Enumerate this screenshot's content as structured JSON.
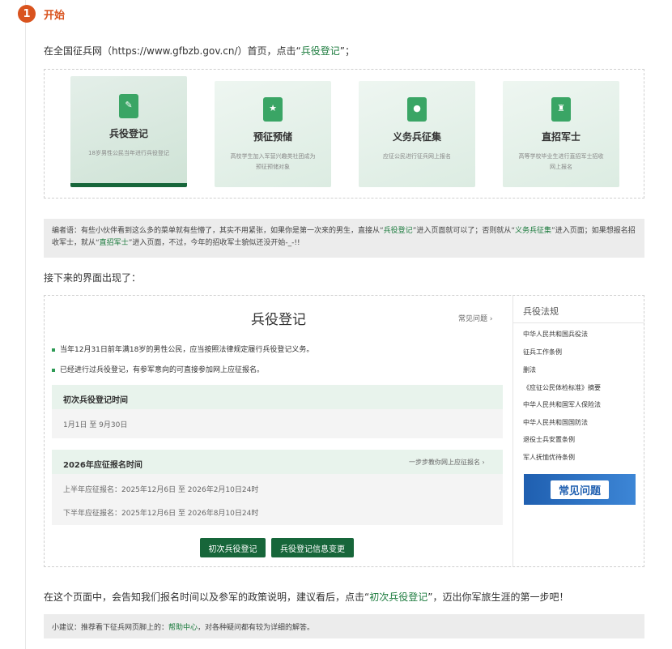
{
  "step": {
    "number": "1",
    "title": "开始"
  },
  "intro": {
    "prefix": "在全国征兵网（https://www.gfbzb.gov.cn/）首页，点击“",
    "link": "兵役登记",
    "suffix": "”；"
  },
  "cards": [
    {
      "title": "兵役登记",
      "desc": "18岁男性公民当年进行兵役登记",
      "icon": "registration-icon",
      "active": true
    },
    {
      "title": "预征预储",
      "desc": "高校学生加入军营兴趣类社团成为预征预储对象",
      "icon": "bookmark-star-icon",
      "active": false
    },
    {
      "title": "义务兵征集",
      "desc": "应征公民进行征兵网上报名",
      "icon": "person-id-icon",
      "active": false
    },
    {
      "title": "直招军士",
      "desc": "高等学校毕业生进行直招军士招收网上报名",
      "icon": "soldier-icon",
      "active": false
    }
  ],
  "note": {
    "p1": "编者语：有些小伙伴看到这么多的菜单就有些懵了，其实不用紧张，如果你是第一次来的男生，直接从“",
    "l1": "兵役登记",
    "p2": "”进入页面就可以了；否则就从“",
    "l2": "义务兵征集",
    "p3": "”进入页面；如果想报名招收军士，就从“",
    "l3": "直招军士",
    "p4": "”进入页面，不过，今年的招收军士貌似还没开始-_-!!"
  },
  "next_text": "接下来的界面出现了：",
  "panel": {
    "title": "兵役登记",
    "faq_link": "常见问题",
    "bullets": [
      "当年12月31日前年满18岁的男性公民，应当按照法律规定履行兵役登记义务。",
      "已经进行过兵役登记，有参军意向的可直接参加网上应征报名。"
    ],
    "sec1": {
      "head": "初次兵役登记时间",
      "body": "1月1日 至 9月30日"
    },
    "sec2": {
      "head": "2026年应征报名时间",
      "link": "一步步教你网上应征报名",
      "row1": "上半年应征报名：2025年12月6日 至 2026年2月10日24时",
      "row2": "下半年应征报名：2025年12月6日 至 2026年8月10日24时"
    },
    "btn1": "初次兵役登记",
    "btn2": "兵役登记信息变更"
  },
  "laws": {
    "title": "兵役法规",
    "items": [
      "中华人民共和国兵役法",
      "征兵工作条例",
      "删法",
      "《应征公民体检标准》摘要",
      "中华人民共和国军人保险法",
      "中华人民共和国国防法",
      "退役士兵安置条例",
      "军人抚恤优待条例"
    ],
    "banner": "常见问题"
  },
  "closing": {
    "prefix": "在这个页面中，会告知我们报名时间以及参军的政策说明，建议看后，点击“",
    "link": "初次兵役登记",
    "suffix": "”，迈出你军旅生涯的第一步吧！"
  },
  "tip": {
    "prefix": "小建议：推荐看下征兵网页脚上的：",
    "link": "帮助中心",
    "suffix": "，对各种疑问都有较为详细的解答。"
  },
  "colors": {
    "accent": "#d9531e",
    "brand_green": "#17663a",
    "link_green": "#1a7a3c"
  }
}
